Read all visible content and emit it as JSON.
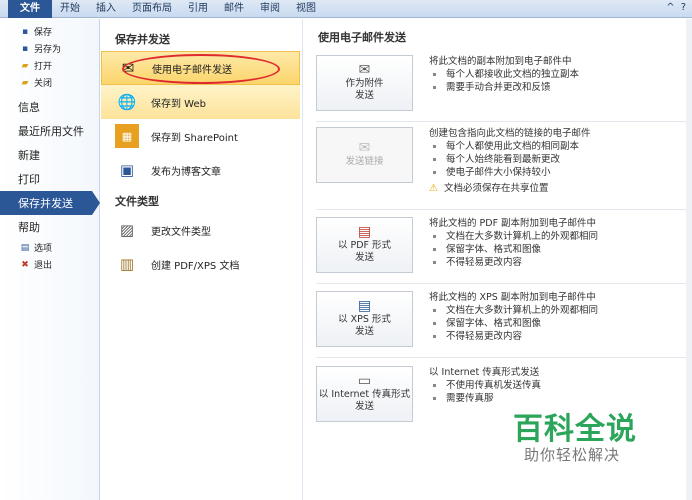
{
  "ribbon": {
    "tabs": [
      "文件",
      "开始",
      "插入",
      "页面布局",
      "引用",
      "邮件",
      "审阅",
      "视图"
    ],
    "controls": [
      "^",
      "?"
    ]
  },
  "leftnav": {
    "items_small_top": [
      {
        "label": "保存",
        "icon": "save-icon"
      },
      {
        "label": "另存为",
        "icon": "save-as-icon"
      },
      {
        "label": "打开",
        "icon": "open-folder-icon"
      },
      {
        "label": "关闭",
        "icon": "close-doc-icon"
      }
    ],
    "items_big": [
      "信息",
      "最近所用文件",
      "新建",
      "打印",
      "保存并发送",
      "帮助"
    ],
    "items_small_bottom": [
      {
        "label": "选项",
        "icon": "options-icon"
      },
      {
        "label": "退出",
        "icon": "exit-icon"
      }
    ]
  },
  "mid": {
    "section1_title": "保存并发送",
    "section1_items": [
      {
        "label": "使用电子邮件发送",
        "icon": "email-icon"
      },
      {
        "label": "保存到 Web",
        "icon": "globe-icon"
      },
      {
        "label": "保存到 SharePoint",
        "icon": "sharepoint-icon"
      },
      {
        "label": "发布为博客文章",
        "icon": "blog-icon"
      }
    ],
    "section2_title": "文件类型",
    "section2_items": [
      {
        "label": "更改文件类型",
        "icon": "change-filetype-icon"
      },
      {
        "label": "创建 PDF/XPS 文档",
        "icon": "pdf-xps-icon"
      }
    ]
  },
  "right": {
    "title": "使用电子邮件发送",
    "groups": [
      {
        "button": "作为附件\n发送",
        "btn1": "作为附件",
        "btn2": "发送",
        "heading": "将此文档的副本附加到电子邮件中",
        "bullets": [
          "每个人都接收此文档的独立副本",
          "需要手动合并更改和反馈"
        ]
      },
      {
        "btn1": "发送链接",
        "btn2": "",
        "heading": "创建包含指向此文档的链接的电子邮件",
        "bullets": [
          "每个人都使用此文档的相同副本",
          "每个人始终能看到最新更改",
          "使电子邮件大小保持较小"
        ],
        "warning": "文档必须保存在共享位置"
      },
      {
        "btn1": "以 PDF 形式",
        "btn2": "发送",
        "heading": "将此文档的 PDF 副本附加到电子邮件中",
        "bullets": [
          "文档在大多数计算机上的外观都相同",
          "保留字体、格式和图像",
          "不得轻易更改内容"
        ]
      },
      {
        "btn1": "以 XPS 形式",
        "btn2": "发送",
        "heading": "将此文档的 XPS 副本附加到电子邮件中",
        "bullets": [
          "文档在大多数计算机上的外观都相同",
          "保留字体、格式和图像",
          "不得轻易更改内容"
        ]
      },
      {
        "btn1": "以 Internet 传真形式",
        "btn2": "发送",
        "heading": "以 Internet 传真形式发送",
        "bullets": [
          "不使用传真机发送传真",
          "需要传真服"
        ]
      }
    ]
  },
  "watermark": {
    "line1": "百科全说",
    "line2": "助你轻松解决"
  },
  "colors": {
    "accent": "#2b5797",
    "selected": "#fbd56b",
    "annotation": "#e0292e",
    "watermark": "#2aa55a"
  }
}
